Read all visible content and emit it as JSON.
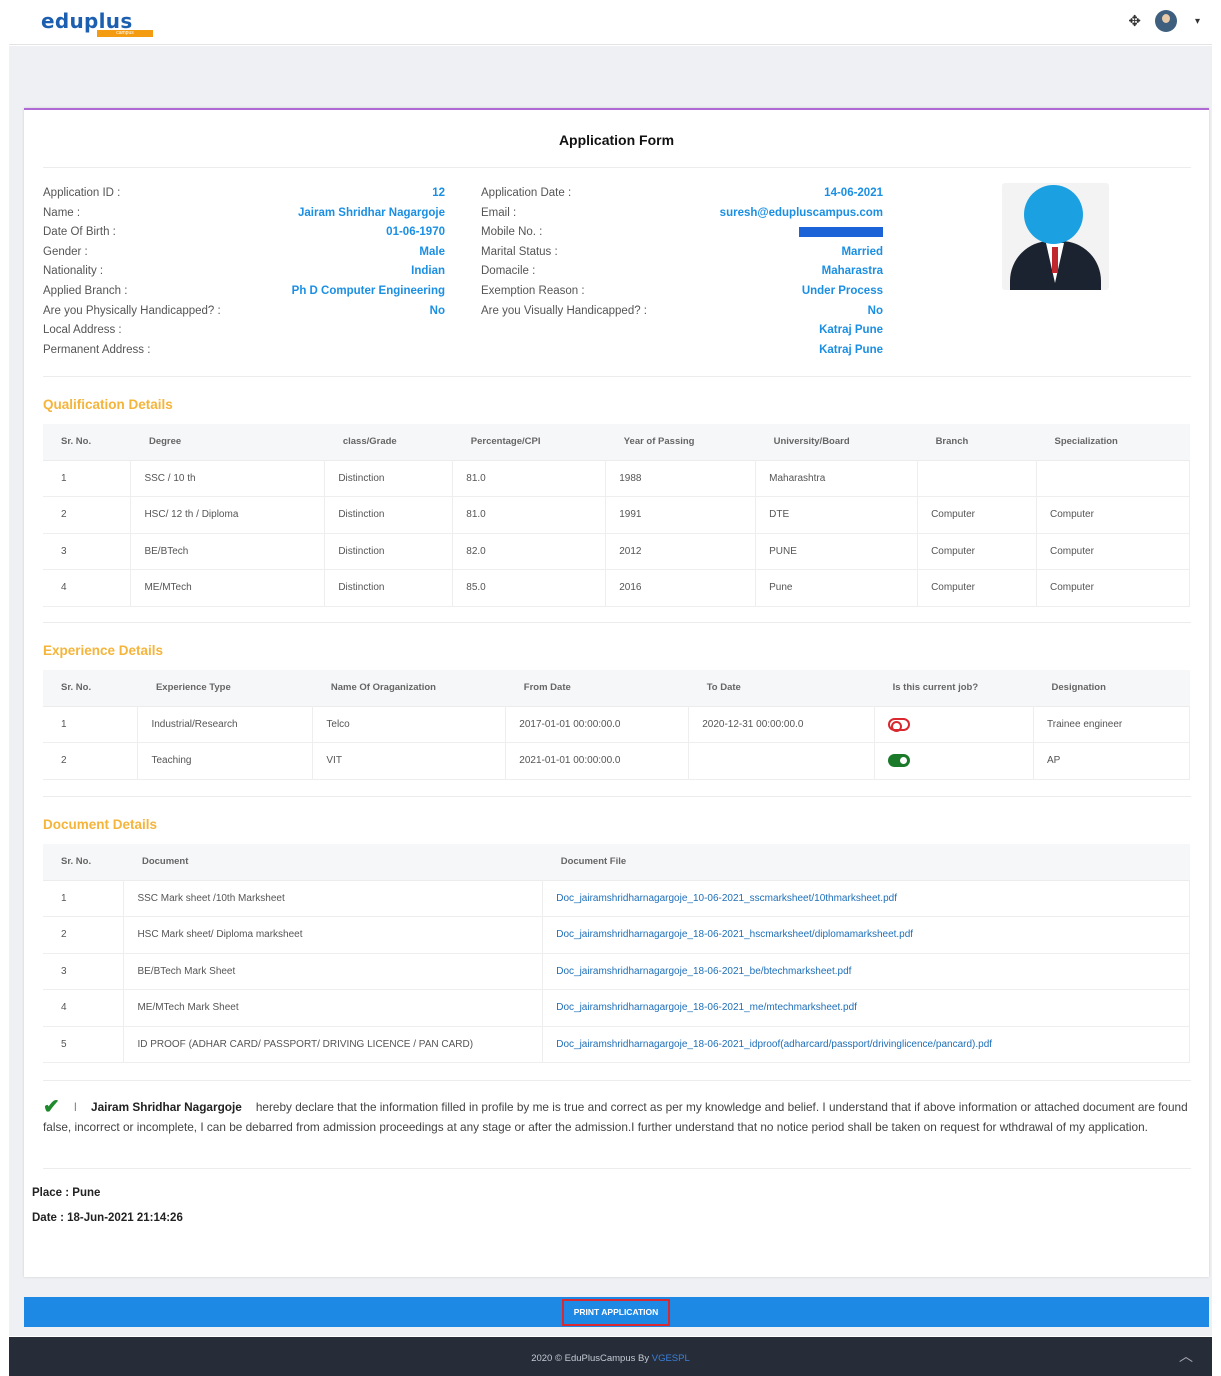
{
  "header": {
    "logo_text": "eduplus",
    "logo_sub": "campus"
  },
  "form": {
    "title": "Application Form",
    "left": [
      {
        "label": "Application ID :",
        "value": "12"
      },
      {
        "label": "Name :",
        "value": "Jairam Shridhar Nagargoje"
      },
      {
        "label": "Date Of Birth :",
        "value": "01-06-1970"
      },
      {
        "label": "Gender :",
        "value": "Male"
      },
      {
        "label": "Nationality :",
        "value": "Indian"
      },
      {
        "label": "Applied Branch :",
        "value": "Ph D Computer Engineering"
      },
      {
        "label": "Are you Physically Handicapped? :",
        "value": "No"
      },
      {
        "label": "Local Address :",
        "value": ""
      },
      {
        "label": "Permanent Address :",
        "value": ""
      }
    ],
    "right": [
      {
        "label": "Application Date :",
        "value": "14-06-2021"
      },
      {
        "label": "Email :",
        "value": "suresh@edupluscampus.com"
      },
      {
        "label": "Mobile No. :",
        "value": ""
      },
      {
        "label": "Marital Status :",
        "value": "Married"
      },
      {
        "label": "Domacile :",
        "value": "Maharastra"
      },
      {
        "label": "Exemption Reason :",
        "value": "Under Process"
      },
      {
        "label": "Are you Visually Handicapped? :",
        "value": "No"
      },
      {
        "label": "",
        "value": "Katraj Pune"
      },
      {
        "label": "",
        "value": "Katraj Pune"
      }
    ]
  },
  "qualification": {
    "title": "Qualification Details",
    "headers": [
      "Sr. No.",
      "Degree",
      "class/Grade",
      "Percentage/CPI",
      "Year of Passing",
      "University/Board",
      "Branch",
      "Specialization"
    ],
    "rows": [
      [
        "1",
        "SSC / 10 th",
        "Distinction",
        "81.0",
        "1988",
        "Maharashtra",
        "",
        ""
      ],
      [
        "2",
        "HSC/ 12 th / Diploma",
        "Distinction",
        "81.0",
        "1991",
        "DTE",
        "Computer",
        "Computer"
      ],
      [
        "3",
        "BE/BTech",
        "Distinction",
        "82.0",
        "2012",
        "PUNE",
        "Computer",
        "Computer"
      ],
      [
        "4",
        "ME/MTech",
        "Distinction",
        "85.0",
        "2016",
        "Pune",
        "Computer",
        "Computer"
      ]
    ]
  },
  "experience": {
    "title": "Experience Details",
    "headers": [
      "Sr. No.",
      "Experience Type",
      "Name Of Oraganization",
      "From Date",
      "To Date",
      "Is this current job?",
      "Designation"
    ],
    "rows": [
      {
        "sr": "1",
        "type": "Industrial/Research",
        "org": "Telco",
        "from": "2017-01-01 00:00:00.0",
        "to": "2020-12-31 00:00:00.0",
        "current": false,
        "designation": "Trainee engineer"
      },
      {
        "sr": "2",
        "type": "Teaching",
        "org": "VIT",
        "from": "2021-01-01 00:00:00.0",
        "to": "",
        "current": true,
        "designation": "AP"
      }
    ]
  },
  "documents": {
    "title": "Document Details",
    "headers": [
      "Sr. No.",
      "Document",
      "Document File"
    ],
    "rows": [
      [
        "1",
        "SSC Mark sheet /10th Marksheet",
        "Doc_jairamshridharnagargoje_10-06-2021_sscmarksheet/10thmarksheet.pdf"
      ],
      [
        "2",
        "HSC Mark sheet/ Diploma marksheet",
        "Doc_jairamshridharnagargoje_18-06-2021_hscmarksheet/diplomamarksheet.pdf"
      ],
      [
        "3",
        "BE/BTech Mark Sheet",
        "Doc_jairamshridharnagargoje_18-06-2021_be/btechmarksheet.pdf"
      ],
      [
        "4",
        "ME/MTech Mark Sheet",
        "Doc_jairamshridharnagargoje_18-06-2021_me/mtechmarksheet.pdf"
      ],
      [
        "5",
        "ID PROOF (ADHAR CARD/ PASSPORT/ DRIVING LICENCE / PAN CARD)",
        "Doc_jairamshridharnagargoje_18-06-2021_idproof(adharcard/passport/drivinglicence/pancard).pdf"
      ]
    ]
  },
  "declaration": {
    "prefix": "I",
    "name": "Jairam Shridhar Nagargoje",
    "text": "hereby declare that the information filled in profile by me is true and correct as per my knowledge and belief. I understand that if above information or attached document are found false, incorrect or incomplete, I can be debarred from admission proceedings at any stage or after the admission.I further understand that no notice period shall be taken on request for wthdrawal of my application."
  },
  "place": "Place : Pune",
  "date": "Date : 18-Jun-2021 21:14:26",
  "print_label": "PRINT APPLICATION",
  "footer": {
    "text": "2020 © EduPlusCampus By ",
    "vendor": "VGESPL"
  }
}
